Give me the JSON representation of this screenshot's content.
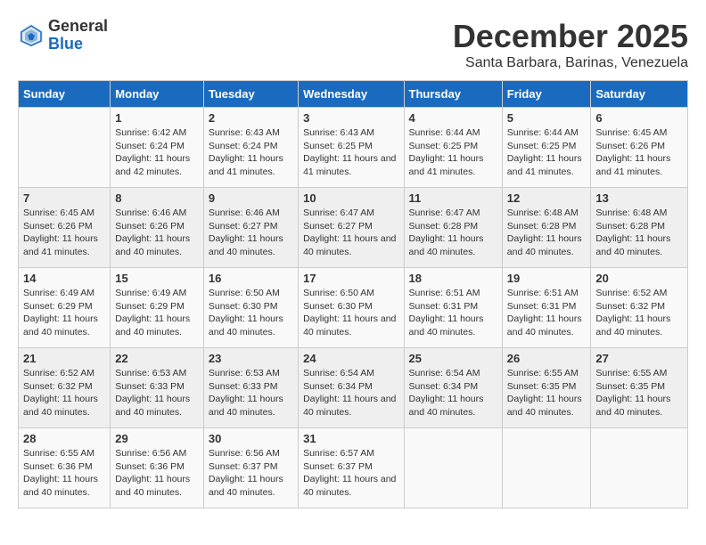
{
  "logo": {
    "general": "General",
    "blue": "Blue"
  },
  "title": "December 2025",
  "subtitle": "Santa Barbara, Barinas, Venezuela",
  "days_of_week": [
    "Sunday",
    "Monday",
    "Tuesday",
    "Wednesday",
    "Thursday",
    "Friday",
    "Saturday"
  ],
  "weeks": [
    [
      {
        "day": "",
        "sunrise": "",
        "sunset": "",
        "daylight": ""
      },
      {
        "day": "1",
        "sunrise": "Sunrise: 6:42 AM",
        "sunset": "Sunset: 6:24 PM",
        "daylight": "Daylight: 11 hours and 42 minutes."
      },
      {
        "day": "2",
        "sunrise": "Sunrise: 6:43 AM",
        "sunset": "Sunset: 6:24 PM",
        "daylight": "Daylight: 11 hours and 41 minutes."
      },
      {
        "day": "3",
        "sunrise": "Sunrise: 6:43 AM",
        "sunset": "Sunset: 6:25 PM",
        "daylight": "Daylight: 11 hours and 41 minutes."
      },
      {
        "day": "4",
        "sunrise": "Sunrise: 6:44 AM",
        "sunset": "Sunset: 6:25 PM",
        "daylight": "Daylight: 11 hours and 41 minutes."
      },
      {
        "day": "5",
        "sunrise": "Sunrise: 6:44 AM",
        "sunset": "Sunset: 6:25 PM",
        "daylight": "Daylight: 11 hours and 41 minutes."
      },
      {
        "day": "6",
        "sunrise": "Sunrise: 6:45 AM",
        "sunset": "Sunset: 6:26 PM",
        "daylight": "Daylight: 11 hours and 41 minutes."
      }
    ],
    [
      {
        "day": "7",
        "sunrise": "Sunrise: 6:45 AM",
        "sunset": "Sunset: 6:26 PM",
        "daylight": "Daylight: 11 hours and 41 minutes."
      },
      {
        "day": "8",
        "sunrise": "Sunrise: 6:46 AM",
        "sunset": "Sunset: 6:26 PM",
        "daylight": "Daylight: 11 hours and 40 minutes."
      },
      {
        "day": "9",
        "sunrise": "Sunrise: 6:46 AM",
        "sunset": "Sunset: 6:27 PM",
        "daylight": "Daylight: 11 hours and 40 minutes."
      },
      {
        "day": "10",
        "sunrise": "Sunrise: 6:47 AM",
        "sunset": "Sunset: 6:27 PM",
        "daylight": "Daylight: 11 hours and 40 minutes."
      },
      {
        "day": "11",
        "sunrise": "Sunrise: 6:47 AM",
        "sunset": "Sunset: 6:28 PM",
        "daylight": "Daylight: 11 hours and 40 minutes."
      },
      {
        "day": "12",
        "sunrise": "Sunrise: 6:48 AM",
        "sunset": "Sunset: 6:28 PM",
        "daylight": "Daylight: 11 hours and 40 minutes."
      },
      {
        "day": "13",
        "sunrise": "Sunrise: 6:48 AM",
        "sunset": "Sunset: 6:28 PM",
        "daylight": "Daylight: 11 hours and 40 minutes."
      }
    ],
    [
      {
        "day": "14",
        "sunrise": "Sunrise: 6:49 AM",
        "sunset": "Sunset: 6:29 PM",
        "daylight": "Daylight: 11 hours and 40 minutes."
      },
      {
        "day": "15",
        "sunrise": "Sunrise: 6:49 AM",
        "sunset": "Sunset: 6:29 PM",
        "daylight": "Daylight: 11 hours and 40 minutes."
      },
      {
        "day": "16",
        "sunrise": "Sunrise: 6:50 AM",
        "sunset": "Sunset: 6:30 PM",
        "daylight": "Daylight: 11 hours and 40 minutes."
      },
      {
        "day": "17",
        "sunrise": "Sunrise: 6:50 AM",
        "sunset": "Sunset: 6:30 PM",
        "daylight": "Daylight: 11 hours and 40 minutes."
      },
      {
        "day": "18",
        "sunrise": "Sunrise: 6:51 AM",
        "sunset": "Sunset: 6:31 PM",
        "daylight": "Daylight: 11 hours and 40 minutes."
      },
      {
        "day": "19",
        "sunrise": "Sunrise: 6:51 AM",
        "sunset": "Sunset: 6:31 PM",
        "daylight": "Daylight: 11 hours and 40 minutes."
      },
      {
        "day": "20",
        "sunrise": "Sunrise: 6:52 AM",
        "sunset": "Sunset: 6:32 PM",
        "daylight": "Daylight: 11 hours and 40 minutes."
      }
    ],
    [
      {
        "day": "21",
        "sunrise": "Sunrise: 6:52 AM",
        "sunset": "Sunset: 6:32 PM",
        "daylight": "Daylight: 11 hours and 40 minutes."
      },
      {
        "day": "22",
        "sunrise": "Sunrise: 6:53 AM",
        "sunset": "Sunset: 6:33 PM",
        "daylight": "Daylight: 11 hours and 40 minutes."
      },
      {
        "day": "23",
        "sunrise": "Sunrise: 6:53 AM",
        "sunset": "Sunset: 6:33 PM",
        "daylight": "Daylight: 11 hours and 40 minutes."
      },
      {
        "day": "24",
        "sunrise": "Sunrise: 6:54 AM",
        "sunset": "Sunset: 6:34 PM",
        "daylight": "Daylight: 11 hours and 40 minutes."
      },
      {
        "day": "25",
        "sunrise": "Sunrise: 6:54 AM",
        "sunset": "Sunset: 6:34 PM",
        "daylight": "Daylight: 11 hours and 40 minutes."
      },
      {
        "day": "26",
        "sunrise": "Sunrise: 6:55 AM",
        "sunset": "Sunset: 6:35 PM",
        "daylight": "Daylight: 11 hours and 40 minutes."
      },
      {
        "day": "27",
        "sunrise": "Sunrise: 6:55 AM",
        "sunset": "Sunset: 6:35 PM",
        "daylight": "Daylight: 11 hours and 40 minutes."
      }
    ],
    [
      {
        "day": "28",
        "sunrise": "Sunrise: 6:55 AM",
        "sunset": "Sunset: 6:36 PM",
        "daylight": "Daylight: 11 hours and 40 minutes."
      },
      {
        "day": "29",
        "sunrise": "Sunrise: 6:56 AM",
        "sunset": "Sunset: 6:36 PM",
        "daylight": "Daylight: 11 hours and 40 minutes."
      },
      {
        "day": "30",
        "sunrise": "Sunrise: 6:56 AM",
        "sunset": "Sunset: 6:37 PM",
        "daylight": "Daylight: 11 hours and 40 minutes."
      },
      {
        "day": "31",
        "sunrise": "Sunrise: 6:57 AM",
        "sunset": "Sunset: 6:37 PM",
        "daylight": "Daylight: 11 hours and 40 minutes."
      },
      {
        "day": "",
        "sunrise": "",
        "sunset": "",
        "daylight": ""
      },
      {
        "day": "",
        "sunrise": "",
        "sunset": "",
        "daylight": ""
      },
      {
        "day": "",
        "sunrise": "",
        "sunset": "",
        "daylight": ""
      }
    ]
  ]
}
